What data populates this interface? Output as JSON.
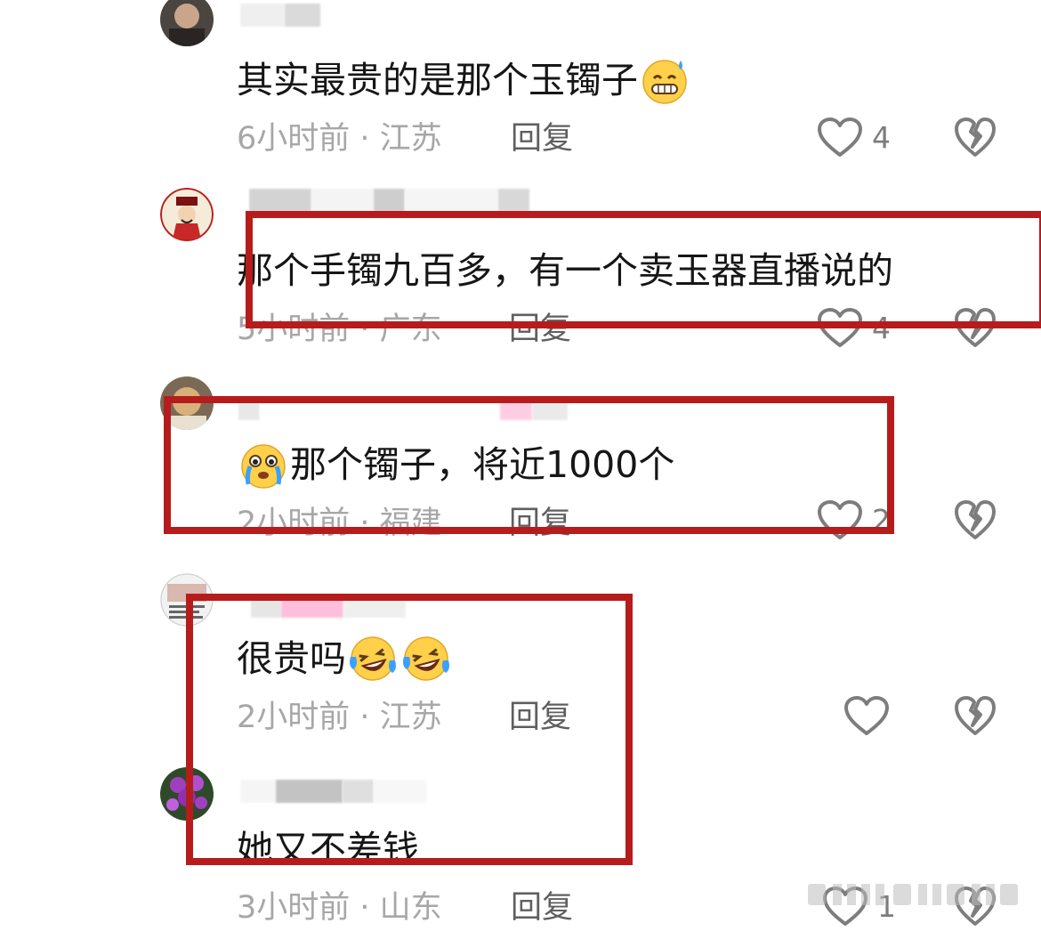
{
  "comments": [
    {
      "text": "其实最贵的是那个玉镯子",
      "emoji_after": [
        "grin-sweat-emoji"
      ],
      "time_location": "6小时前 · 江苏",
      "reply_label": "回复",
      "likes": "4"
    },
    {
      "text": "那个手镯九百多，有一个卖玉器直播说的",
      "time_location": "5小时前 · 广东",
      "reply_label": "回复",
      "likes": "4"
    },
    {
      "text": "那个镯子，将近1000个",
      "emoji_before": [
        "crying-face-emoji"
      ],
      "time_location": "2小时前 · 福建",
      "reply_label": "回复",
      "likes": "2"
    },
    {
      "text": "很贵吗",
      "emoji_after": [
        "laughing-tears-emoji",
        "laughing-tears-emoji"
      ],
      "time_location": "2小时前 · 江苏",
      "reply_label": "回复",
      "likes": ""
    },
    {
      "text": "她又不差钱",
      "time_location": "3小时前 · 山东",
      "reply_label": "回复",
      "likes": "1"
    }
  ],
  "colors": {
    "highlight_box": "#b71c1c",
    "text_primary": "#161616",
    "text_meta": "#a7a7a7",
    "text_reply": "#5f5f5f",
    "icon": "#7d7d7d"
  }
}
